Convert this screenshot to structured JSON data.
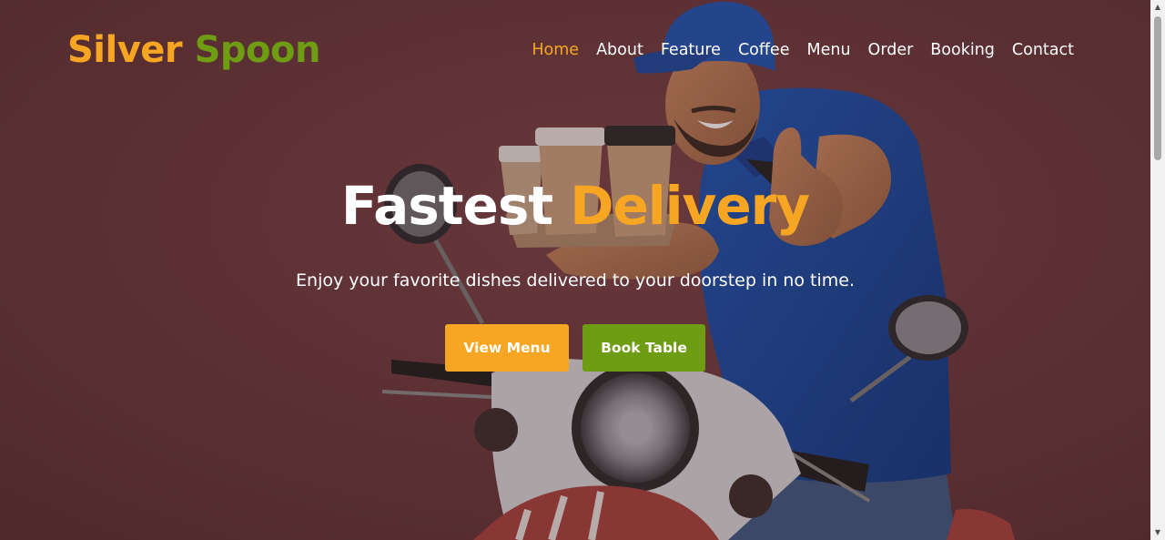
{
  "brand": {
    "word1": "Silver",
    "word2": "Spoon",
    "color1": "#f6a623",
    "color2": "#6e9c12"
  },
  "nav": {
    "items": [
      {
        "label": "Home",
        "active": true
      },
      {
        "label": "About",
        "active": false
      },
      {
        "label": "Feature",
        "active": false
      },
      {
        "label": "Coffee",
        "active": false
      },
      {
        "label": "Menu",
        "active": false
      },
      {
        "label": "Order",
        "active": false
      },
      {
        "label": "Booking",
        "active": false
      },
      {
        "label": "Contact",
        "active": false
      }
    ]
  },
  "hero": {
    "title_main": "Fastest",
    "title_accent": "Delivery",
    "subtitle": "Enjoy your favorite dishes delivered to your doorstep in no time.",
    "buttons": {
      "view_menu": "View Menu",
      "book_table": "Book Table"
    }
  },
  "colors": {
    "accent": "#f6a623",
    "secondary": "#6e9c12",
    "background": "#6a3b3d"
  },
  "scrollbar": {
    "up_icon": "▲",
    "down_icon": "▼"
  }
}
